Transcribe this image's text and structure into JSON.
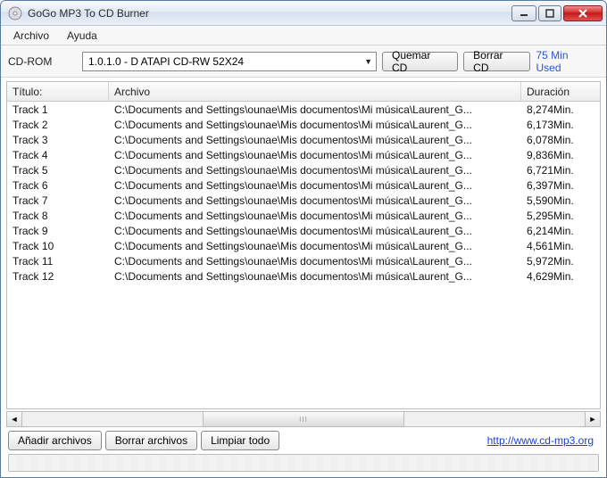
{
  "window": {
    "title": "GoGo MP3 To CD Burner"
  },
  "menu": {
    "archivo": "Archivo",
    "ayuda": "Ayuda"
  },
  "toolbar": {
    "cdrom_label": "CD-ROM",
    "drive_value": "1.0.1.0 - D  ATAPI   CD-RW 52X24",
    "burn_label": "Quemar CD",
    "erase_label": "Borrar CD",
    "used_label": "75 Min Used"
  },
  "columns": {
    "title": "Título:",
    "file": "Archivo",
    "duration": "Duración"
  },
  "tracks": [
    {
      "title": "Track 1",
      "file": "C:\\Documents and Settings\\ounae\\Mis documentos\\Mi música\\Laurent_G...",
      "duration": "8,274Min."
    },
    {
      "title": "Track 2",
      "file": "C:\\Documents and Settings\\ounae\\Mis documentos\\Mi música\\Laurent_G...",
      "duration": "6,173Min."
    },
    {
      "title": "Track 3",
      "file": "C:\\Documents and Settings\\ounae\\Mis documentos\\Mi música\\Laurent_G...",
      "duration": "6,078Min."
    },
    {
      "title": "Track 4",
      "file": "C:\\Documents and Settings\\ounae\\Mis documentos\\Mi música\\Laurent_G...",
      "duration": "9,836Min."
    },
    {
      "title": "Track 5",
      "file": "C:\\Documents and Settings\\ounae\\Mis documentos\\Mi música\\Laurent_G...",
      "duration": "6,721Min."
    },
    {
      "title": "Track 6",
      "file": "C:\\Documents and Settings\\ounae\\Mis documentos\\Mi música\\Laurent_G...",
      "duration": "6,397Min."
    },
    {
      "title": "Track 7",
      "file": "C:\\Documents and Settings\\ounae\\Mis documentos\\Mi música\\Laurent_G...",
      "duration": "5,590Min."
    },
    {
      "title": "Track 8",
      "file": "C:\\Documents and Settings\\ounae\\Mis documentos\\Mi música\\Laurent_G...",
      "duration": "5,295Min."
    },
    {
      "title": "Track 9",
      "file": "C:\\Documents and Settings\\ounae\\Mis documentos\\Mi música\\Laurent_G...",
      "duration": "6,214Min."
    },
    {
      "title": "Track 10",
      "file": "C:\\Documents and Settings\\ounae\\Mis documentos\\Mi música\\Laurent_G...",
      "duration": "4,561Min."
    },
    {
      "title": "Track 11",
      "file": "C:\\Documents and Settings\\ounae\\Mis documentos\\Mi música\\Laurent_G...",
      "duration": "5,972Min."
    },
    {
      "title": "Track 12",
      "file": "C:\\Documents and Settings\\ounae\\Mis documentos\\Mi música\\Laurent_G...",
      "duration": "4,629Min."
    }
  ],
  "bottom": {
    "add_files": "Añadir archivos",
    "remove_files": "Borrar archivos",
    "clear_all": "Limpiar todo",
    "link_text": "http://www.cd-mp3.org"
  }
}
